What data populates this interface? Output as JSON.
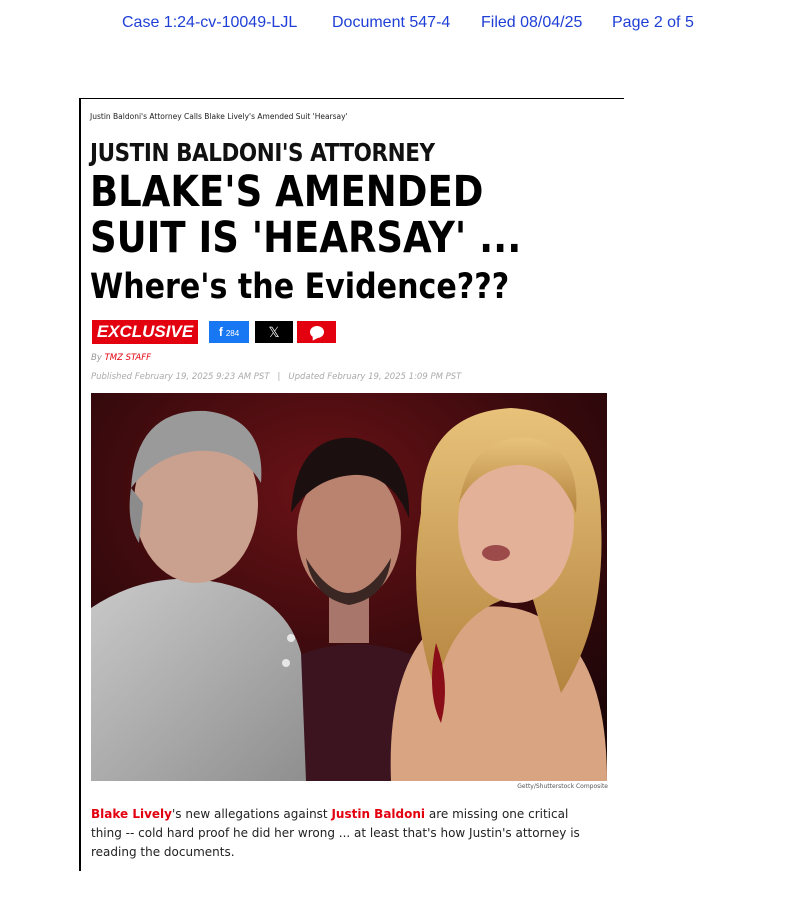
{
  "court_header": {
    "case": "Case 1:24-cv-10049-LJL",
    "document": "Document 547-4",
    "filed": "Filed 08/04/25",
    "page": "Page 2 of 5"
  },
  "article": {
    "breadcrumb": "Justin Baldoni's Attorney Calls Blake Lively's Amended Suit 'Hearsay'",
    "kicker": "JUSTIN BALDONI'S ATTORNEY",
    "headline_line1": "BLAKE'S AMENDED",
    "headline_line2": "SUIT IS 'HEARSAY' ...",
    "subheadline": "Where's the Evidence???",
    "badge": "EXCLUSIVE",
    "share": {
      "facebook_icon": "f",
      "facebook_count": "284",
      "x_icon": "𝕏",
      "comment_icon": "comment-icon"
    },
    "byline_prefix": "By",
    "author": "TMZ STAFF",
    "published": "Published February 19, 2025 9:23 AM PST",
    "separator": "|",
    "updated": "Updated February 19, 2025 1:09 PM PST",
    "photo_credit": "Getty/Shutterstock Composite",
    "body": {
      "name1": "Blake Lively",
      "text1": "'s new allegations against ",
      "name2": "Justin Baldoni",
      "text2": " are missing one critical thing -- cold hard proof he did her wrong ... at least that's how Justin's attorney is reading the documents."
    }
  },
  "colors": {
    "header_blue": "#1f3fd6",
    "tmz_red": "#e3000f",
    "facebook_blue": "#1877f2"
  }
}
